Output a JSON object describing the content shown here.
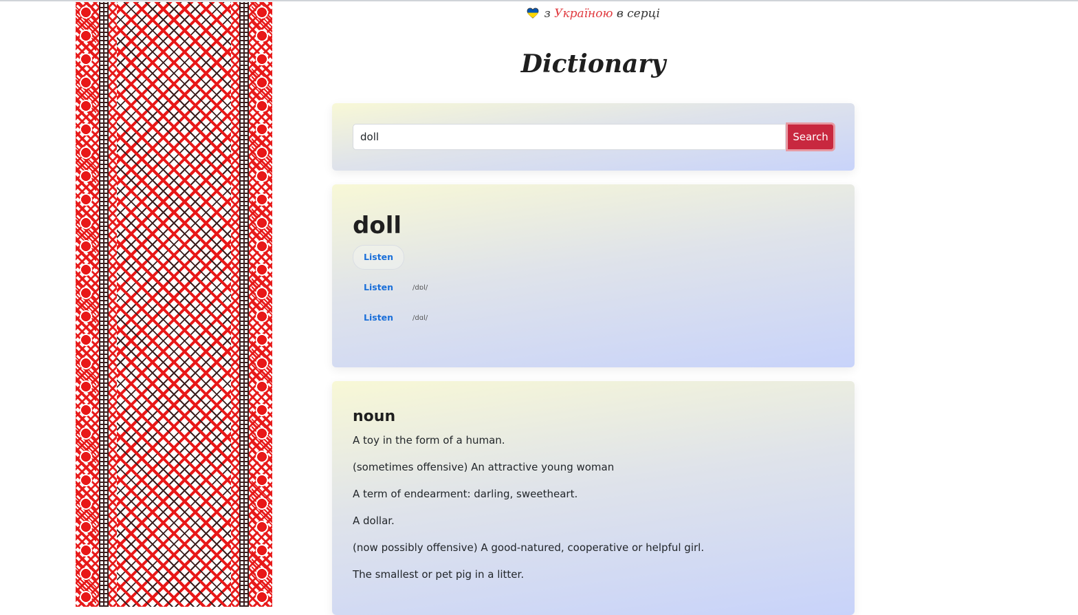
{
  "banner": {
    "prefix": "з",
    "accent": "Україною",
    "suffix": "в серці"
  },
  "page": {
    "title": "Dictionary"
  },
  "search": {
    "value": "doll",
    "button_label": "Search"
  },
  "entry": {
    "word": "doll",
    "phonetics": [
      {
        "listen_label": "Listen",
        "text": ""
      },
      {
        "listen_label": "Listen",
        "text": "/dɒl/"
      },
      {
        "listen_label": "Listen",
        "text": "/dɑl/"
      }
    ]
  },
  "meaning": {
    "part_of_speech": "noun",
    "definitions": [
      "A toy in the form of a human.",
      "(sometimes offensive) An attractive young woman",
      "A term of endearment: darling, sweetheart.",
      "A dollar.",
      "(now possibly offensive) A good-natured, cooperative or helpful girl.",
      "The smallest or pet pig in a litter."
    ]
  },
  "colors": {
    "accent_red": "#c8283f",
    "link_blue": "#1a6fd9",
    "ukraine_blue": "#0057b7",
    "ukraine_yellow": "#ffd700"
  }
}
